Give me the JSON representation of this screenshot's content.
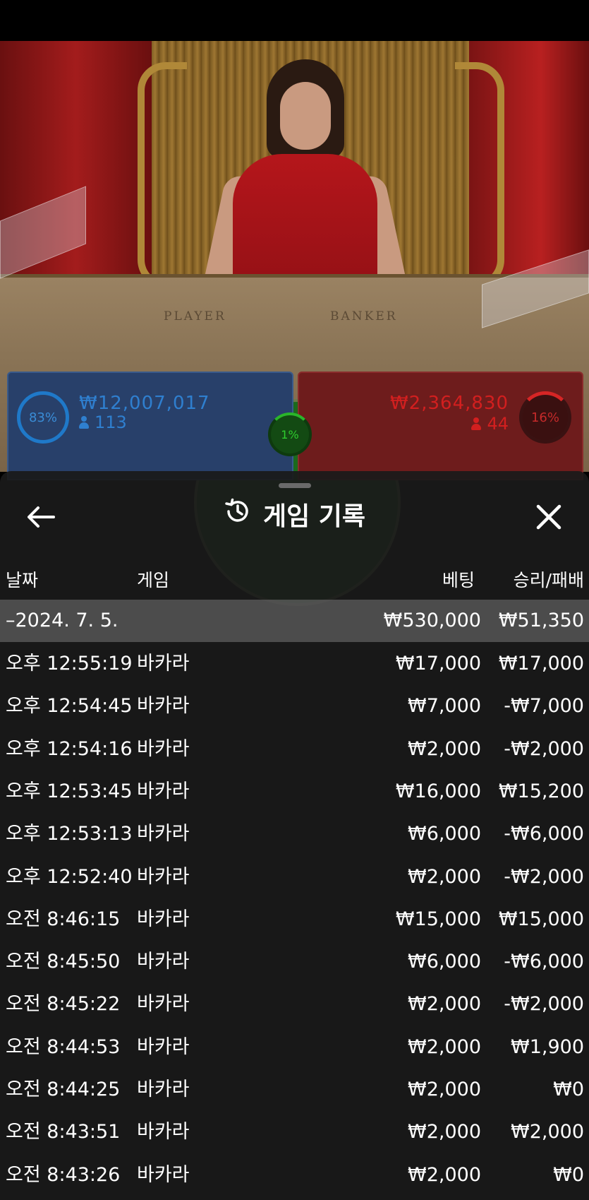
{
  "table_video": {
    "player_label": "PLAYER",
    "banker_label": "BANKER"
  },
  "bets": {
    "player": {
      "percent": "83%",
      "amount": "₩12,007,017",
      "count": "113"
    },
    "banker": {
      "percent": "16%",
      "amount": "₩2,364,830",
      "count": "44"
    },
    "tie": {
      "percent": "1%"
    }
  },
  "history": {
    "title": "게임 기록",
    "columns": {
      "date": "날짜",
      "game": "게임",
      "bet": "베팅",
      "win_loss": "승리/패배"
    },
    "date_group": {
      "label": "–2024. 7. 5.",
      "bet": "₩530,000",
      "win_loss": "₩51,350"
    },
    "rows": [
      {
        "time": "오후 12:55:19",
        "game": "바카라",
        "bet": "₩17,000",
        "win_loss": "₩17,000"
      },
      {
        "time": "오후 12:54:45",
        "game": "바카라",
        "bet": "₩7,000",
        "win_loss": "-₩7,000"
      },
      {
        "time": "오후 12:54:16",
        "game": "바카라",
        "bet": "₩2,000",
        "win_loss": "-₩2,000"
      },
      {
        "time": "오후 12:53:45",
        "game": "바카라",
        "bet": "₩16,000",
        "win_loss": "₩15,200"
      },
      {
        "time": "오후 12:53:13",
        "game": "바카라",
        "bet": "₩6,000",
        "win_loss": "-₩6,000"
      },
      {
        "time": "오후 12:52:40",
        "game": "바카라",
        "bet": "₩2,000",
        "win_loss": "-₩2,000"
      },
      {
        "time": "오전 8:46:15",
        "game": "바카라",
        "bet": "₩15,000",
        "win_loss": "₩15,000"
      },
      {
        "time": "오전 8:45:50",
        "game": "바카라",
        "bet": "₩6,000",
        "win_loss": "-₩6,000"
      },
      {
        "time": "오전 8:45:22",
        "game": "바카라",
        "bet": "₩2,000",
        "win_loss": "-₩2,000"
      },
      {
        "time": "오전 8:44:53",
        "game": "바카라",
        "bet": "₩2,000",
        "win_loss": "₩1,900"
      },
      {
        "time": "오전 8:44:25",
        "game": "바카라",
        "bet": "₩2,000",
        "win_loss": "₩0"
      },
      {
        "time": "오전 8:43:51",
        "game": "바카라",
        "bet": "₩2,000",
        "win_loss": "₩2,000"
      },
      {
        "time": "오전 8:43:26",
        "game": "바카라",
        "bet": "₩2,000",
        "win_loss": "₩0"
      }
    ]
  },
  "colors": {
    "player_blue": "#1f79c9",
    "banker_red": "#d21f1f",
    "tie_green": "#2ecc2e",
    "sheet_bg": "#1a1a1a"
  }
}
